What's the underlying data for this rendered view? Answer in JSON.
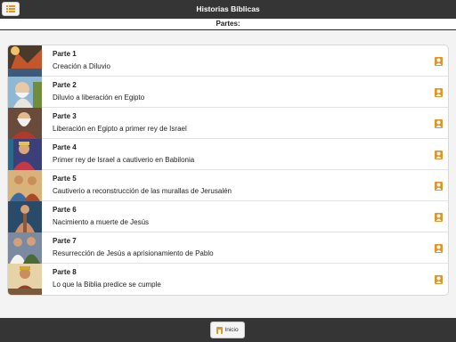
{
  "header": {
    "title": "Historias Bíblicas",
    "menu_icon": "list-icon"
  },
  "subheader": {
    "label": "Partes:"
  },
  "colors": {
    "bar": "#353535",
    "accent": "#e0952a"
  },
  "parts": [
    {
      "title": "Parte 1",
      "description": "Creación a Diluvio",
      "icon": "person-icon"
    },
    {
      "title": "Parte 2",
      "description": "Diluvio a liberación en Egipto",
      "icon": "person-icon"
    },
    {
      "title": "Parte 3",
      "description": "Liberación en Egipto a primer rey de Israel",
      "icon": "person-icon"
    },
    {
      "title": "Parte 4",
      "description": "Primer rey de Israel a cautiverio en Babilonia",
      "icon": "person-icon"
    },
    {
      "title": "Parte 5",
      "description": "Cautiverio a reconstrucción de las murallas de Jerusalén",
      "icon": "person-icon"
    },
    {
      "title": "Parte 6",
      "description": "Nacimiento a muerte de Jesús",
      "icon": "person-icon"
    },
    {
      "title": "Parte 7",
      "description": "Resurrección de Jesús a aprisionamiento de Pablo",
      "icon": "person-icon"
    },
    {
      "title": "Parte 8",
      "description": "Lo que la Biblia predice se cumple",
      "icon": "person-icon"
    }
  ],
  "footer": {
    "home_label": "Inicio",
    "home_icon": "home-icon"
  }
}
